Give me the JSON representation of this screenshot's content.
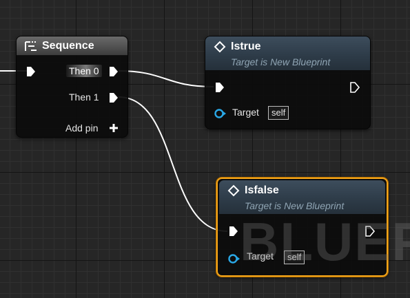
{
  "window": {
    "watermark": "BLUEP"
  },
  "colors": {
    "exec_pin": "#ffffff",
    "object_pin": "#2aa8e6",
    "selection_outline": "#f4a51a",
    "function_header": "#2e3c49",
    "sequence_header": "#545454"
  },
  "nodes": {
    "sequence": {
      "icon": "sequence-icon",
      "title": "Sequence",
      "outputs": [
        "Then 0",
        "Then 1"
      ],
      "add_pin": "Add pin",
      "add_pin_icon": "plus-icon"
    },
    "istrue": {
      "icon": "function-diamond-icon",
      "title": "Istrue",
      "subtitle": "Target is New Blueprint",
      "target_label": "Target",
      "target_value": "self"
    },
    "isfalse": {
      "icon": "function-diamond-icon",
      "title": "Isfalse",
      "subtitle": "Target is New Blueprint",
      "target_label": "Target",
      "target_value": "self",
      "selected": true
    }
  }
}
